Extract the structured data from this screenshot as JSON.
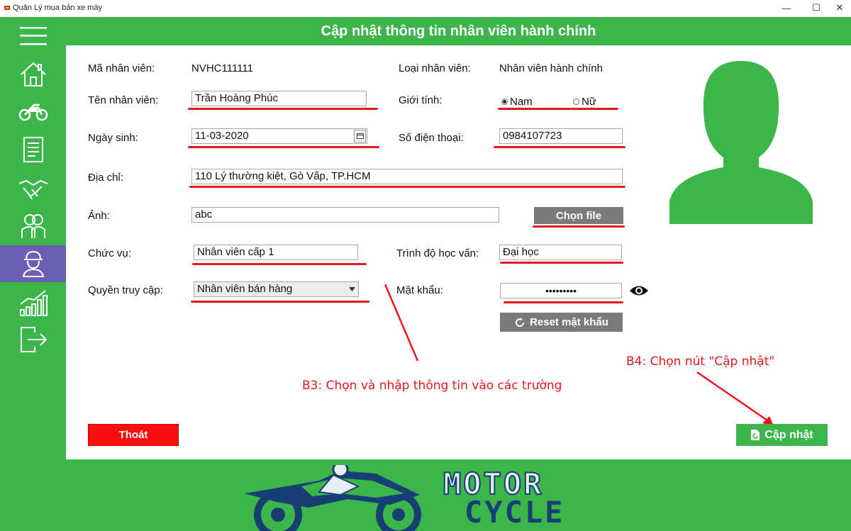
{
  "window": {
    "title": "Quản Lý mua bán xe máy",
    "minimize": "—",
    "maximize": "☐",
    "close": "✕"
  },
  "sidebar": {
    "items": [
      {
        "icon": "menu-icon"
      },
      {
        "icon": "home-icon"
      },
      {
        "icon": "motorcycle-icon"
      },
      {
        "icon": "document-icon"
      },
      {
        "icon": "handshake-icon"
      },
      {
        "icon": "customers-icon"
      },
      {
        "icon": "employee-icon",
        "active": true
      },
      {
        "icon": "statistics-icon"
      },
      {
        "icon": "logout-icon"
      }
    ]
  },
  "header": {
    "title": "Cập nhật thông tin nhân viên hành chính"
  },
  "form": {
    "employee_id_label": "Mã nhân viên:",
    "employee_id_value": "NVHC111111",
    "employee_type_label": "Loại nhân viên:",
    "employee_type_value": "Nhân viên hành chính",
    "name_label": "Tên nhân viên:",
    "name_value": "Trần Hoàng Phúc",
    "gender_label": "Giới tính:",
    "gender_male": "Nam",
    "gender_female": "Nữ",
    "birthdate_label": "Ngày sinh:",
    "birthdate_value": "11-03-2020",
    "phone_label": "Số điện thoại:",
    "phone_value": "0984107723",
    "address_label": "Địa chỉ:",
    "address_value": "110 Lý thường kiệt, Gò Vấp, TP.HCM",
    "photo_label": "Ảnh:",
    "photo_value": "abc",
    "choose_file": "Chọn file",
    "position_label": "Chức vụ:",
    "position_value": "Nhân viên cấp 1",
    "education_label": "Trình độ học vấn:",
    "education_value": "Đại học",
    "access_label": "Quyền truy cập:",
    "access_value": "Nhân viên bán hàng",
    "password_label": "Mật khẩu:",
    "password_value": "•••••••••",
    "reset_password": "Reset mật khẩu"
  },
  "annotations": {
    "step3": "B3: Chọn và nhập thông tin vào các trường",
    "step4": "B4: Chọn nút \"Cập nhật\""
  },
  "buttons": {
    "exit": "Thoát",
    "update": "Cập nhật"
  },
  "footer_logo": {
    "line1": "MOTOR",
    "line2": "CYCLE"
  },
  "colors": {
    "brand_green": "#3cb54a",
    "active_sidebar": "#6a5fb5",
    "annotation_red": "#e8161d",
    "exit_red": "#fa0d0d",
    "gray_button": "#7a7a7a"
  }
}
